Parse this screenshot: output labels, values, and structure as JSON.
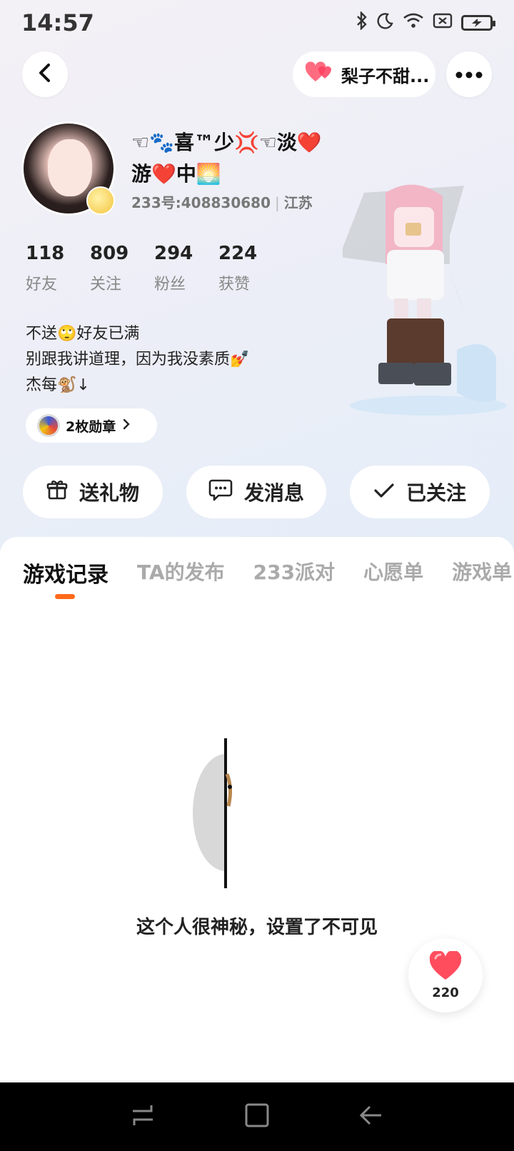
{
  "status_bar": {
    "time": "14:57",
    "battery_label": ""
  },
  "header": {
    "friend_name": "梨子不甜..."
  },
  "profile": {
    "nickname_line1": "☜🐾喜™少💢☜淡❤️",
    "nickname_line2": "游❤️中🌅",
    "id": "233号:408830680",
    "location": "江苏",
    "stats": [
      {
        "value": "118",
        "label": "好友"
      },
      {
        "value": "809",
        "label": "关注"
      },
      {
        "value": "294",
        "label": "粉丝"
      },
      {
        "value": "224",
        "label": "获赞"
      }
    ],
    "bio": [
      "不送🙄好友已满",
      "别跟我讲道理，因为我没素质💅",
      "杰每🐒↓"
    ],
    "badges_label": "2枚勋章"
  },
  "actions": {
    "gift": "送礼物",
    "message": "发消息",
    "followed": "已关注"
  },
  "tabs": [
    "游戏记录",
    "TA的发布",
    "233派对",
    "心愿单",
    "游戏单"
  ],
  "active_tab": 0,
  "empty_state": "这个人很神秘，设置了不可见",
  "like": {
    "count": "220"
  },
  "colors": {
    "accent": "#ff6a1a",
    "heart": "#ff4d5e"
  }
}
